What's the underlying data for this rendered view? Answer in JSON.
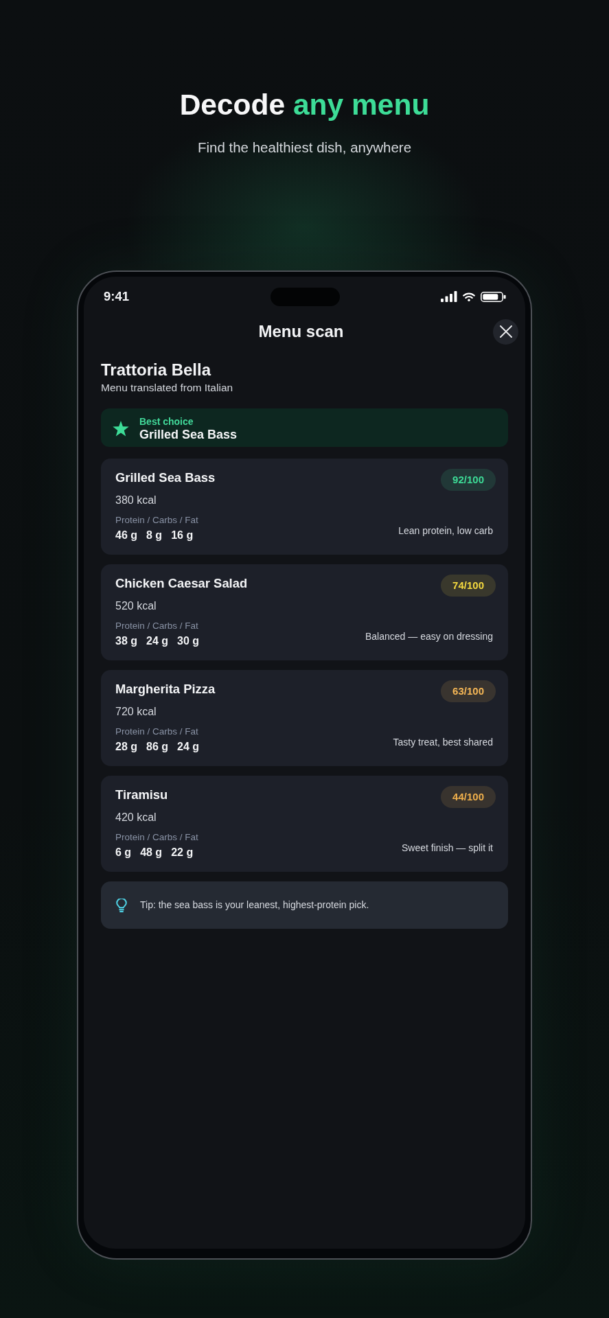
{
  "header": {
    "title": "Decode",
    "title_accent": "any menu",
    "subtitle": "Find the healthiest dish, anywhere"
  },
  "status_bar": {
    "time": "9:41"
  },
  "screen": {
    "title": "Menu scan"
  },
  "restaurant": {
    "name": "Trattoria Bella",
    "subtitle": "Menu translated from Italian"
  },
  "best_choice": {
    "label": "Best choice",
    "dish": "Grilled Sea Bass"
  },
  "dishes": [
    {
      "name": "Grilled Sea Bass",
      "score": "92/100",
      "color": "#3ddc97",
      "kcal": "380 kcal",
      "macro_label": "Protein / Carbs / Fat",
      "macros": [
        "46 g",
        "8 g",
        "16 g"
      ],
      "note": "Lean protein, low carb"
    },
    {
      "name": "Chicken Caesar Salad",
      "score": "74/100",
      "color": "#f4d93f",
      "kcal": "520 kcal",
      "macro_label": "Protein / Carbs / Fat",
      "macros": [
        "38 g",
        "24 g",
        "30 g"
      ],
      "note": "Balanced — easy on dressing"
    },
    {
      "name": "Margherita Pizza",
      "score": "63/100",
      "color": "#f6b756",
      "kcal": "720 kcal",
      "macro_label": "Protein / Carbs / Fat",
      "macros": [
        "28 g",
        "86 g",
        "24 g"
      ],
      "note": "Tasty treat, best shared"
    },
    {
      "name": "Tiramisu",
      "score": "44/100",
      "color": "#f0b04c",
      "kcal": "420 kcal",
      "macro_label": "Protein / Carbs / Fat",
      "macros": [
        "6 g",
        "48 g",
        "22 g"
      ],
      "note": "Sweet finish — split it"
    }
  ],
  "tip": {
    "text": "Tip: the sea bass is your leanest, highest-protein pick."
  }
}
